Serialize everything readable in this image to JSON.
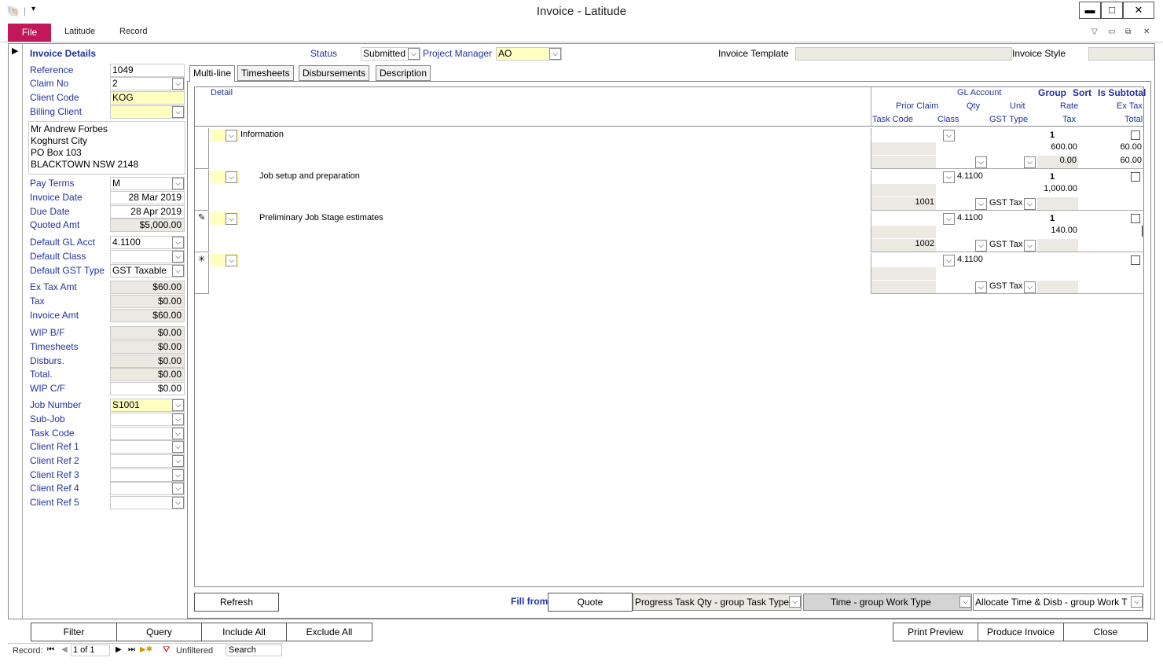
{
  "window": {
    "title": "Invoice - Latitude",
    "min_label": "▬",
    "max_label": "□",
    "close_label": "✕"
  },
  "ribbon": {
    "tabs": [
      "File",
      "Latitude",
      "Record"
    ],
    "right_icons": [
      "▽",
      "▭",
      "⧉",
      "✕"
    ]
  },
  "header": {
    "section": "Invoice Details",
    "status_label": "Status",
    "status_value": "Submitted",
    "pm_label": "Project Manager",
    "pm_value": "AO",
    "template_label": "Invoice Template",
    "template_value": "",
    "style_label": "Invoice Style",
    "style_value": ""
  },
  "left": {
    "reference_label": "Reference",
    "reference": "1049",
    "claim_label": "Claim No",
    "claim": "2",
    "client_code_label": "Client Code",
    "client_code": "KOG",
    "billing_label": "Billing Client",
    "billing": "",
    "address": [
      "Mr Andrew Forbes",
      "Koghurst City",
      "PO Box 103",
      "BLACKTOWN  NSW  2148"
    ],
    "pay_terms_label": "Pay Terms",
    "pay_terms": "M",
    "invoice_date_label": "Invoice Date",
    "invoice_date": "28 Mar 2019",
    "due_date_label": "Due Date",
    "due_date": "28 Apr 2019",
    "quoted_label": "Quoted Amt",
    "quoted": "$5,000.00",
    "gl_label": "Default GL Acct",
    "gl": "4.1100",
    "class_label": "Default Class",
    "class": "",
    "gst_label": "Default GST Type",
    "gst": "GST Taxable",
    "extax_label": "Ex Tax Amt",
    "extax": "$60.00",
    "tax_label": "Tax",
    "tax": "$0.00",
    "invamt_label": "Invoice Amt",
    "invamt": "$60.00",
    "wipbf_label": "WIP B/F",
    "wipbf": "$0.00",
    "timesheets_label": "Timesheets",
    "timesheets": "$0.00",
    "disburs_label": "Disburs.",
    "disburs": "$0.00",
    "total_label": "Total.",
    "total": "$0.00",
    "wipcf_label": "WIP C/F",
    "wipcf": "$0.00",
    "job_label": "Job Number",
    "job": "S1001",
    "subjob_label": "Sub-Job",
    "taskcode_label": "Task Code",
    "cref1_label": "Client Ref 1",
    "cref2_label": "Client Ref 2",
    "cref3_label": "Client Ref 3",
    "cref4_label": "Client Ref 4",
    "cref5_label": "Client Ref 5"
  },
  "tabs": [
    "Multi-line",
    "Timesheets",
    "Disbursements",
    "Description"
  ],
  "grid_headers": {
    "detail": "Detail",
    "gl": "GL Account",
    "group": "Group",
    "sort": "Sort",
    "subtotal": "Is Subtotal",
    "prior": "Prior Claim",
    "qty": "Qty",
    "unit": "Unit",
    "rate": "Rate",
    "extax": "Ex Tax",
    "taskcode": "Task Code",
    "class": "Class",
    "gsttype": "GST Type",
    "tax": "Tax",
    "total": "Total"
  },
  "rows": [
    {
      "detail": "Information",
      "gl": "",
      "sort": "1",
      "prior": "",
      "rate": "600.00",
      "extax": "60.00",
      "taskcode": "",
      "gst": "",
      "tax": "0.00",
      "total": "60.00",
      "selector": ""
    },
    {
      "detail": "Job setup and preparation",
      "gl": "4.1100",
      "sort": "1",
      "prior": "",
      "rate": "1,000.00",
      "extax": "",
      "taskcode": "1001",
      "gst": "GST Tax",
      "tax": "",
      "total": "",
      "selector": ""
    },
    {
      "detail": "Preliminary Job Stage estimates",
      "gl": "4.1100",
      "sort": "1",
      "prior": "",
      "rate": "140.00",
      "extax": "",
      "taskcode": "1002",
      "gst": "GST Tax",
      "tax": "",
      "total": "",
      "selector": "✎"
    },
    {
      "detail": "",
      "gl": "4.1100",
      "sort": "",
      "prior": "",
      "rate": "",
      "extax": "",
      "taskcode": "",
      "gst": "GST Tax",
      "tax": "",
      "total": "",
      "selector": "✳"
    }
  ],
  "bottom": {
    "refresh": "Refresh",
    "fill_from": "Fill from",
    "quote": "Quote",
    "progress": "Progress Task Qty - group Task Type",
    "time": "Time - group Work Type",
    "allocate": "Allocate Time & Disb - group Work T"
  },
  "actions": {
    "filter": "Filter",
    "query": "Query",
    "include_all": "Include All",
    "exclude_all": "Exclude All",
    "print_preview": "Print Preview",
    "produce_invoice": "Produce Invoice",
    "close": "Close"
  },
  "nav": {
    "record_label": "Record:",
    "position": "1 of 1",
    "filter_status": "Unfiltered",
    "search": "Search"
  }
}
